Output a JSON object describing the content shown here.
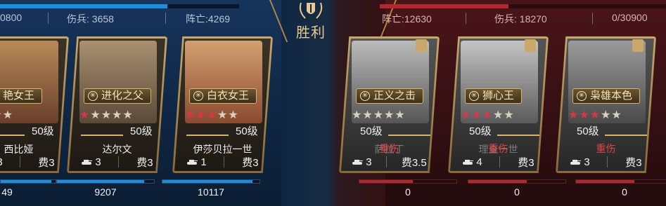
{
  "left_side": {
    "total_label": "0800",
    "wounded_label": "伤兵: 3658",
    "dead_label": "阵亡:4269",
    "accent": "#1b8ee0"
  },
  "right_side": {
    "dead_label": "阵亡:12630",
    "wounded_label": "伤兵: 18270",
    "total_label": "0/30900",
    "accent": "#b3282e"
  },
  "center": {
    "result": "胜利",
    "badge_icon": "laurel-shield-icon"
  },
  "cards": [
    {
      "id": "c1",
      "side": "left",
      "name_plate": "艳女王",
      "stars_on": 0,
      "stars_total": 3,
      "level": "50级",
      "hero_name": "西比娅",
      "status": "",
      "tank_count": "3",
      "cost_label": "费3",
      "hp_value": "49",
      "hp_fill": 0.92
    },
    {
      "id": "c2",
      "side": "left",
      "name_plate": "进化之父",
      "stars_on": 1,
      "stars_total": 5,
      "level": "50级",
      "hero_name": "达尔文",
      "status": "",
      "tank_count": "3",
      "cost_label": "费3",
      "hp_value": "9207",
      "hp_fill": 0.9
    },
    {
      "id": "c3",
      "side": "left",
      "name_plate": "白衣女王",
      "stars_on": 3,
      "stars_total": 5,
      "level": "50级",
      "hero_name": "伊莎贝拉一世",
      "status": "",
      "tank_count": "1",
      "cost_label": "费3",
      "hp_value": "10117",
      "hp_fill": 0.93
    },
    {
      "id": "c4",
      "side": "right",
      "name_plate": "正义之击",
      "stars_on": 0,
      "stars_total": 5,
      "level": "50级",
      "hero_name": "萨拉丁",
      "status": "重伤",
      "tank_count": "3",
      "cost_label": "费3.5",
      "hp_value": "0",
      "hp_fill": 0.55
    },
    {
      "id": "c5",
      "side": "right",
      "name_plate": "狮心王",
      "stars_on": 3,
      "stars_total": 5,
      "level": "50级",
      "hero_name": "理查一世",
      "status": "重伤",
      "tank_count": "4",
      "cost_label": "费3",
      "hp_value": "0",
      "hp_fill": 0.6
    },
    {
      "id": "c6",
      "side": "right",
      "name_plate": "枭雄本色",
      "stars_on": 3,
      "stars_total": 5,
      "level": "50级",
      "hero_name": "",
      "status": "重伤",
      "tank_count": "3",
      "cost_label": "费3",
      "hp_value": "0",
      "hp_fill": 0.6
    }
  ]
}
